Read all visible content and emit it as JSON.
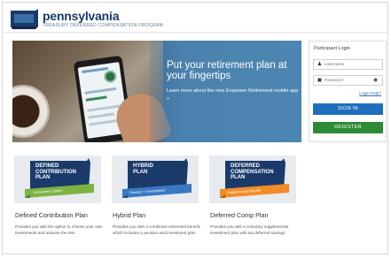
{
  "header": {
    "logo_text": "pennsylvania",
    "logo_tagline": "TREASURY DEFERRED COMPENSATION PROGRAM"
  },
  "hero": {
    "title": "Put your retirement plan at your fingertips",
    "link_text": "Learn more about the new Empower Retirement mobile app »"
  },
  "login": {
    "title": "Participant Login",
    "username_placeholder": "Username",
    "password_placeholder": "Password",
    "help_link": "Login help?",
    "signin_label": "SIGN IN",
    "register_label": "REGISTER"
  },
  "plans": [
    {
      "badge_line1": "DEFINED",
      "badge_line2": "CONTRIBUTION",
      "badge_line3": "PLAN",
      "ribbon": "Investment Option",
      "title": "Defined Contribution Plan",
      "description": "Provides you with the option to choose your own investments and assume the risk."
    },
    {
      "badge_line1": "HYBRID",
      "badge_line2": "PLAN",
      "badge_line3": "",
      "ribbon": "Pension + Investments",
      "title": "Hybrid Plan",
      "description": "Provides you with a combined retirement benefit, which includes a pension and investment plan."
    },
    {
      "badge_line1": "DEFERRED",
      "badge_line2": "COMPENSATION",
      "badge_line3": "PLAN",
      "ribbon": "Supplemental Benefit",
      "title": "Deferred Comp Plan",
      "description": "Provides you with a voluntary supplemental investment plan with tax deferred savings."
    }
  ],
  "colors": {
    "brand_navy": "#1b3a6b",
    "signin_blue": "#1d6fbd",
    "register_green": "#2e8a35",
    "ribbon_green": "#7cb342",
    "ribbon_blue": "#3a78c2",
    "ribbon_orange": "#f28c28"
  }
}
